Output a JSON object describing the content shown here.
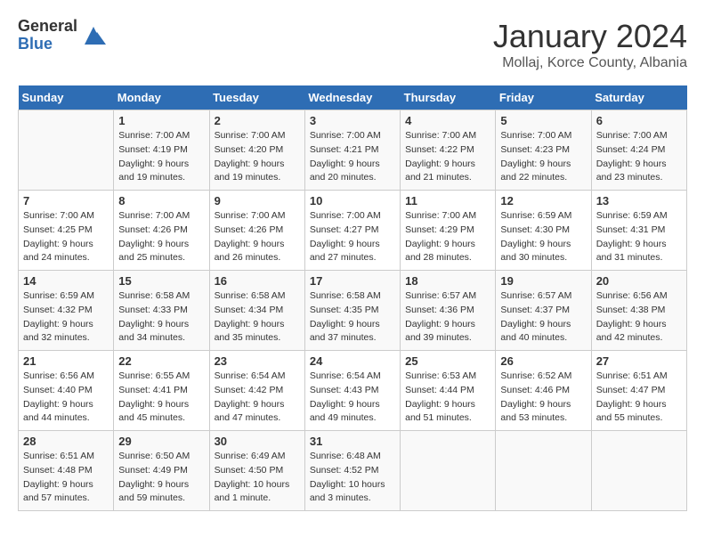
{
  "logo": {
    "general": "General",
    "blue": "Blue"
  },
  "header": {
    "title": "January 2024",
    "subtitle": "Mollaj, Korce County, Albania"
  },
  "weekdays": [
    "Sunday",
    "Monday",
    "Tuesday",
    "Wednesday",
    "Thursday",
    "Friday",
    "Saturday"
  ],
  "weeks": [
    [
      {
        "day": "",
        "sunrise": "",
        "sunset": "",
        "daylight": ""
      },
      {
        "day": "1",
        "sunrise": "Sunrise: 7:00 AM",
        "sunset": "Sunset: 4:19 PM",
        "daylight": "Daylight: 9 hours and 19 minutes."
      },
      {
        "day": "2",
        "sunrise": "Sunrise: 7:00 AM",
        "sunset": "Sunset: 4:20 PM",
        "daylight": "Daylight: 9 hours and 19 minutes."
      },
      {
        "day": "3",
        "sunrise": "Sunrise: 7:00 AM",
        "sunset": "Sunset: 4:21 PM",
        "daylight": "Daylight: 9 hours and 20 minutes."
      },
      {
        "day": "4",
        "sunrise": "Sunrise: 7:00 AM",
        "sunset": "Sunset: 4:22 PM",
        "daylight": "Daylight: 9 hours and 21 minutes."
      },
      {
        "day": "5",
        "sunrise": "Sunrise: 7:00 AM",
        "sunset": "Sunset: 4:23 PM",
        "daylight": "Daylight: 9 hours and 22 minutes."
      },
      {
        "day": "6",
        "sunrise": "Sunrise: 7:00 AM",
        "sunset": "Sunset: 4:24 PM",
        "daylight": "Daylight: 9 hours and 23 minutes."
      }
    ],
    [
      {
        "day": "7",
        "sunrise": "Sunrise: 7:00 AM",
        "sunset": "Sunset: 4:25 PM",
        "daylight": "Daylight: 9 hours and 24 minutes."
      },
      {
        "day": "8",
        "sunrise": "Sunrise: 7:00 AM",
        "sunset": "Sunset: 4:26 PM",
        "daylight": "Daylight: 9 hours and 25 minutes."
      },
      {
        "day": "9",
        "sunrise": "Sunrise: 7:00 AM",
        "sunset": "Sunset: 4:26 PM",
        "daylight": "Daylight: 9 hours and 26 minutes."
      },
      {
        "day": "10",
        "sunrise": "Sunrise: 7:00 AM",
        "sunset": "Sunset: 4:27 PM",
        "daylight": "Daylight: 9 hours and 27 minutes."
      },
      {
        "day": "11",
        "sunrise": "Sunrise: 7:00 AM",
        "sunset": "Sunset: 4:29 PM",
        "daylight": "Daylight: 9 hours and 28 minutes."
      },
      {
        "day": "12",
        "sunrise": "Sunrise: 6:59 AM",
        "sunset": "Sunset: 4:30 PM",
        "daylight": "Daylight: 9 hours and 30 minutes."
      },
      {
        "day": "13",
        "sunrise": "Sunrise: 6:59 AM",
        "sunset": "Sunset: 4:31 PM",
        "daylight": "Daylight: 9 hours and 31 minutes."
      }
    ],
    [
      {
        "day": "14",
        "sunrise": "Sunrise: 6:59 AM",
        "sunset": "Sunset: 4:32 PM",
        "daylight": "Daylight: 9 hours and 32 minutes."
      },
      {
        "day": "15",
        "sunrise": "Sunrise: 6:58 AM",
        "sunset": "Sunset: 4:33 PM",
        "daylight": "Daylight: 9 hours and 34 minutes."
      },
      {
        "day": "16",
        "sunrise": "Sunrise: 6:58 AM",
        "sunset": "Sunset: 4:34 PM",
        "daylight": "Daylight: 9 hours and 35 minutes."
      },
      {
        "day": "17",
        "sunrise": "Sunrise: 6:58 AM",
        "sunset": "Sunset: 4:35 PM",
        "daylight": "Daylight: 9 hours and 37 minutes."
      },
      {
        "day": "18",
        "sunrise": "Sunrise: 6:57 AM",
        "sunset": "Sunset: 4:36 PM",
        "daylight": "Daylight: 9 hours and 39 minutes."
      },
      {
        "day": "19",
        "sunrise": "Sunrise: 6:57 AM",
        "sunset": "Sunset: 4:37 PM",
        "daylight": "Daylight: 9 hours and 40 minutes."
      },
      {
        "day": "20",
        "sunrise": "Sunrise: 6:56 AM",
        "sunset": "Sunset: 4:38 PM",
        "daylight": "Daylight: 9 hours and 42 minutes."
      }
    ],
    [
      {
        "day": "21",
        "sunrise": "Sunrise: 6:56 AM",
        "sunset": "Sunset: 4:40 PM",
        "daylight": "Daylight: 9 hours and 44 minutes."
      },
      {
        "day": "22",
        "sunrise": "Sunrise: 6:55 AM",
        "sunset": "Sunset: 4:41 PM",
        "daylight": "Daylight: 9 hours and 45 minutes."
      },
      {
        "day": "23",
        "sunrise": "Sunrise: 6:54 AM",
        "sunset": "Sunset: 4:42 PM",
        "daylight": "Daylight: 9 hours and 47 minutes."
      },
      {
        "day": "24",
        "sunrise": "Sunrise: 6:54 AM",
        "sunset": "Sunset: 4:43 PM",
        "daylight": "Daylight: 9 hours and 49 minutes."
      },
      {
        "day": "25",
        "sunrise": "Sunrise: 6:53 AM",
        "sunset": "Sunset: 4:44 PM",
        "daylight": "Daylight: 9 hours and 51 minutes."
      },
      {
        "day": "26",
        "sunrise": "Sunrise: 6:52 AM",
        "sunset": "Sunset: 4:46 PM",
        "daylight": "Daylight: 9 hours and 53 minutes."
      },
      {
        "day": "27",
        "sunrise": "Sunrise: 6:51 AM",
        "sunset": "Sunset: 4:47 PM",
        "daylight": "Daylight: 9 hours and 55 minutes."
      }
    ],
    [
      {
        "day": "28",
        "sunrise": "Sunrise: 6:51 AM",
        "sunset": "Sunset: 4:48 PM",
        "daylight": "Daylight: 9 hours and 57 minutes."
      },
      {
        "day": "29",
        "sunrise": "Sunrise: 6:50 AM",
        "sunset": "Sunset: 4:49 PM",
        "daylight": "Daylight: 9 hours and 59 minutes."
      },
      {
        "day": "30",
        "sunrise": "Sunrise: 6:49 AM",
        "sunset": "Sunset: 4:50 PM",
        "daylight": "Daylight: 10 hours and 1 minute."
      },
      {
        "day": "31",
        "sunrise": "Sunrise: 6:48 AM",
        "sunset": "Sunset: 4:52 PM",
        "daylight": "Daylight: 10 hours and 3 minutes."
      },
      {
        "day": "",
        "sunrise": "",
        "sunset": "",
        "daylight": ""
      },
      {
        "day": "",
        "sunrise": "",
        "sunset": "",
        "daylight": ""
      },
      {
        "day": "",
        "sunrise": "",
        "sunset": "",
        "daylight": ""
      }
    ]
  ]
}
